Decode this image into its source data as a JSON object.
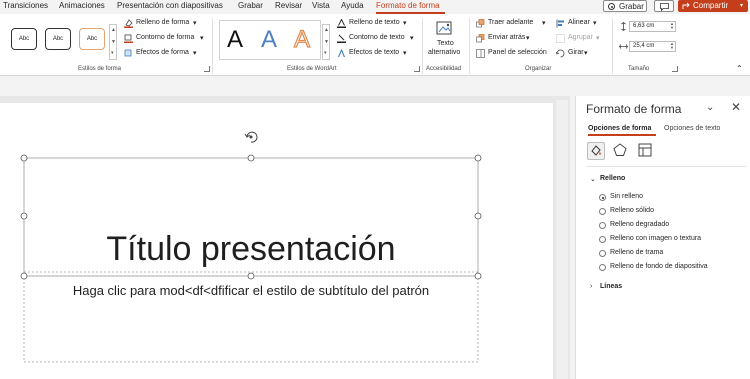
{
  "tabs": [
    {
      "label": "Transiciones",
      "active": false
    },
    {
      "label": "Animaciones",
      "active": false
    },
    {
      "label": "Presentación con diapositivas",
      "active": false
    },
    {
      "label": "Grabar",
      "active": false
    },
    {
      "label": "Revisar",
      "active": false
    },
    {
      "label": "Vista",
      "active": false
    },
    {
      "label": "Ayuda",
      "active": false
    },
    {
      "label": "Formato de forma",
      "active": true
    }
  ],
  "titlebar": {
    "record_label": "Grabar",
    "share_label": "Compartir",
    "comment_icon": "comment-icon",
    "accent": "#c43e1c"
  },
  "ribbon": {
    "shape_styles": {
      "group_label": "Estilos de forma",
      "swatch_label": "Abc",
      "fill_label": "Relleno de forma",
      "outline_label": "Contorno de forma",
      "effects_label": "Efectos de forma"
    },
    "wordart": {
      "group_label": "Estilos de WordArt",
      "glyph": "A",
      "text_fill_label": "Relleno de texto",
      "text_outline_label": "Contorno de texto",
      "text_effects_label": "Efectos de texto"
    },
    "accessibility": {
      "group_label": "Accesibilidad",
      "alt_text_line1": "Texto",
      "alt_text_line2": "alternativo"
    },
    "arrange": {
      "group_label": "Organizar",
      "bring_forward": "Traer adelante",
      "send_backward": "Enviar atrás",
      "selection_pane": "Panel de selección",
      "align": "Alinear",
      "group": "Agrupar",
      "rotate": "Girar"
    },
    "size": {
      "group_label": "Tamaño",
      "height": "6,63 cm",
      "width": "25,4 cm"
    }
  },
  "slide": {
    "title": "Título presentación",
    "subtitle": "Haga clic para mod<df<dfificar el estilo de subtítulo del patrón"
  },
  "format_pane": {
    "title": "Formato de forma",
    "tabs": [
      "Opciones de forma",
      "Opciones de texto"
    ],
    "fill_section": "Relleno",
    "fill_options": [
      {
        "label": "Sin relleno",
        "selected": true
      },
      {
        "label": "Relleno sólido",
        "selected": false
      },
      {
        "label": "Relleno degradado",
        "selected": false
      },
      {
        "label": "Relleno con imagen o textura",
        "selected": false
      },
      {
        "label": "Relleno de trama",
        "selected": false
      },
      {
        "label": "Relleno de fondo de diapositiva",
        "selected": false
      }
    ],
    "lines_section": "Líneas"
  }
}
